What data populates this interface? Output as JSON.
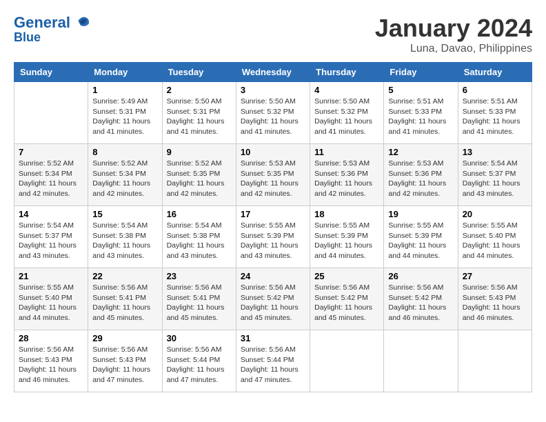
{
  "header": {
    "logo_line1": "General",
    "logo_line2": "Blue",
    "month_title": "January 2024",
    "location": "Luna, Davao, Philippines"
  },
  "weekdays": [
    "Sunday",
    "Monday",
    "Tuesday",
    "Wednesday",
    "Thursday",
    "Friday",
    "Saturday"
  ],
  "weeks": [
    [
      {
        "day": "",
        "info": ""
      },
      {
        "day": "1",
        "info": "Sunrise: 5:49 AM\nSunset: 5:31 PM\nDaylight: 11 hours and 41 minutes."
      },
      {
        "day": "2",
        "info": "Sunrise: 5:50 AM\nSunset: 5:31 PM\nDaylight: 11 hours and 41 minutes."
      },
      {
        "day": "3",
        "info": "Sunrise: 5:50 AM\nSunset: 5:32 PM\nDaylight: 11 hours and 41 minutes."
      },
      {
        "day": "4",
        "info": "Sunrise: 5:50 AM\nSunset: 5:32 PM\nDaylight: 11 hours and 41 minutes."
      },
      {
        "day": "5",
        "info": "Sunrise: 5:51 AM\nSunset: 5:33 PM\nDaylight: 11 hours and 41 minutes."
      },
      {
        "day": "6",
        "info": "Sunrise: 5:51 AM\nSunset: 5:33 PM\nDaylight: 11 hours and 41 minutes."
      }
    ],
    [
      {
        "day": "7",
        "info": "Sunrise: 5:52 AM\nSunset: 5:34 PM\nDaylight: 11 hours and 42 minutes."
      },
      {
        "day": "8",
        "info": "Sunrise: 5:52 AM\nSunset: 5:34 PM\nDaylight: 11 hours and 42 minutes."
      },
      {
        "day": "9",
        "info": "Sunrise: 5:52 AM\nSunset: 5:35 PM\nDaylight: 11 hours and 42 minutes."
      },
      {
        "day": "10",
        "info": "Sunrise: 5:53 AM\nSunset: 5:35 PM\nDaylight: 11 hours and 42 minutes."
      },
      {
        "day": "11",
        "info": "Sunrise: 5:53 AM\nSunset: 5:36 PM\nDaylight: 11 hours and 42 minutes."
      },
      {
        "day": "12",
        "info": "Sunrise: 5:53 AM\nSunset: 5:36 PM\nDaylight: 11 hours and 42 minutes."
      },
      {
        "day": "13",
        "info": "Sunrise: 5:54 AM\nSunset: 5:37 PM\nDaylight: 11 hours and 43 minutes."
      }
    ],
    [
      {
        "day": "14",
        "info": "Sunrise: 5:54 AM\nSunset: 5:37 PM\nDaylight: 11 hours and 43 minutes."
      },
      {
        "day": "15",
        "info": "Sunrise: 5:54 AM\nSunset: 5:38 PM\nDaylight: 11 hours and 43 minutes."
      },
      {
        "day": "16",
        "info": "Sunrise: 5:54 AM\nSunset: 5:38 PM\nDaylight: 11 hours and 43 minutes."
      },
      {
        "day": "17",
        "info": "Sunrise: 5:55 AM\nSunset: 5:39 PM\nDaylight: 11 hours and 43 minutes."
      },
      {
        "day": "18",
        "info": "Sunrise: 5:55 AM\nSunset: 5:39 PM\nDaylight: 11 hours and 44 minutes."
      },
      {
        "day": "19",
        "info": "Sunrise: 5:55 AM\nSunset: 5:39 PM\nDaylight: 11 hours and 44 minutes."
      },
      {
        "day": "20",
        "info": "Sunrise: 5:55 AM\nSunset: 5:40 PM\nDaylight: 11 hours and 44 minutes."
      }
    ],
    [
      {
        "day": "21",
        "info": "Sunrise: 5:55 AM\nSunset: 5:40 PM\nDaylight: 11 hours and 44 minutes."
      },
      {
        "day": "22",
        "info": "Sunrise: 5:56 AM\nSunset: 5:41 PM\nDaylight: 11 hours and 45 minutes."
      },
      {
        "day": "23",
        "info": "Sunrise: 5:56 AM\nSunset: 5:41 PM\nDaylight: 11 hours and 45 minutes."
      },
      {
        "day": "24",
        "info": "Sunrise: 5:56 AM\nSunset: 5:42 PM\nDaylight: 11 hours and 45 minutes."
      },
      {
        "day": "25",
        "info": "Sunrise: 5:56 AM\nSunset: 5:42 PM\nDaylight: 11 hours and 45 minutes."
      },
      {
        "day": "26",
        "info": "Sunrise: 5:56 AM\nSunset: 5:42 PM\nDaylight: 11 hours and 46 minutes."
      },
      {
        "day": "27",
        "info": "Sunrise: 5:56 AM\nSunset: 5:43 PM\nDaylight: 11 hours and 46 minutes."
      }
    ],
    [
      {
        "day": "28",
        "info": "Sunrise: 5:56 AM\nSunset: 5:43 PM\nDaylight: 11 hours and 46 minutes."
      },
      {
        "day": "29",
        "info": "Sunrise: 5:56 AM\nSunset: 5:43 PM\nDaylight: 11 hours and 47 minutes."
      },
      {
        "day": "30",
        "info": "Sunrise: 5:56 AM\nSunset: 5:44 PM\nDaylight: 11 hours and 47 minutes."
      },
      {
        "day": "31",
        "info": "Sunrise: 5:56 AM\nSunset: 5:44 PM\nDaylight: 11 hours and 47 minutes."
      },
      {
        "day": "",
        "info": ""
      },
      {
        "day": "",
        "info": ""
      },
      {
        "day": "",
        "info": ""
      }
    ]
  ]
}
